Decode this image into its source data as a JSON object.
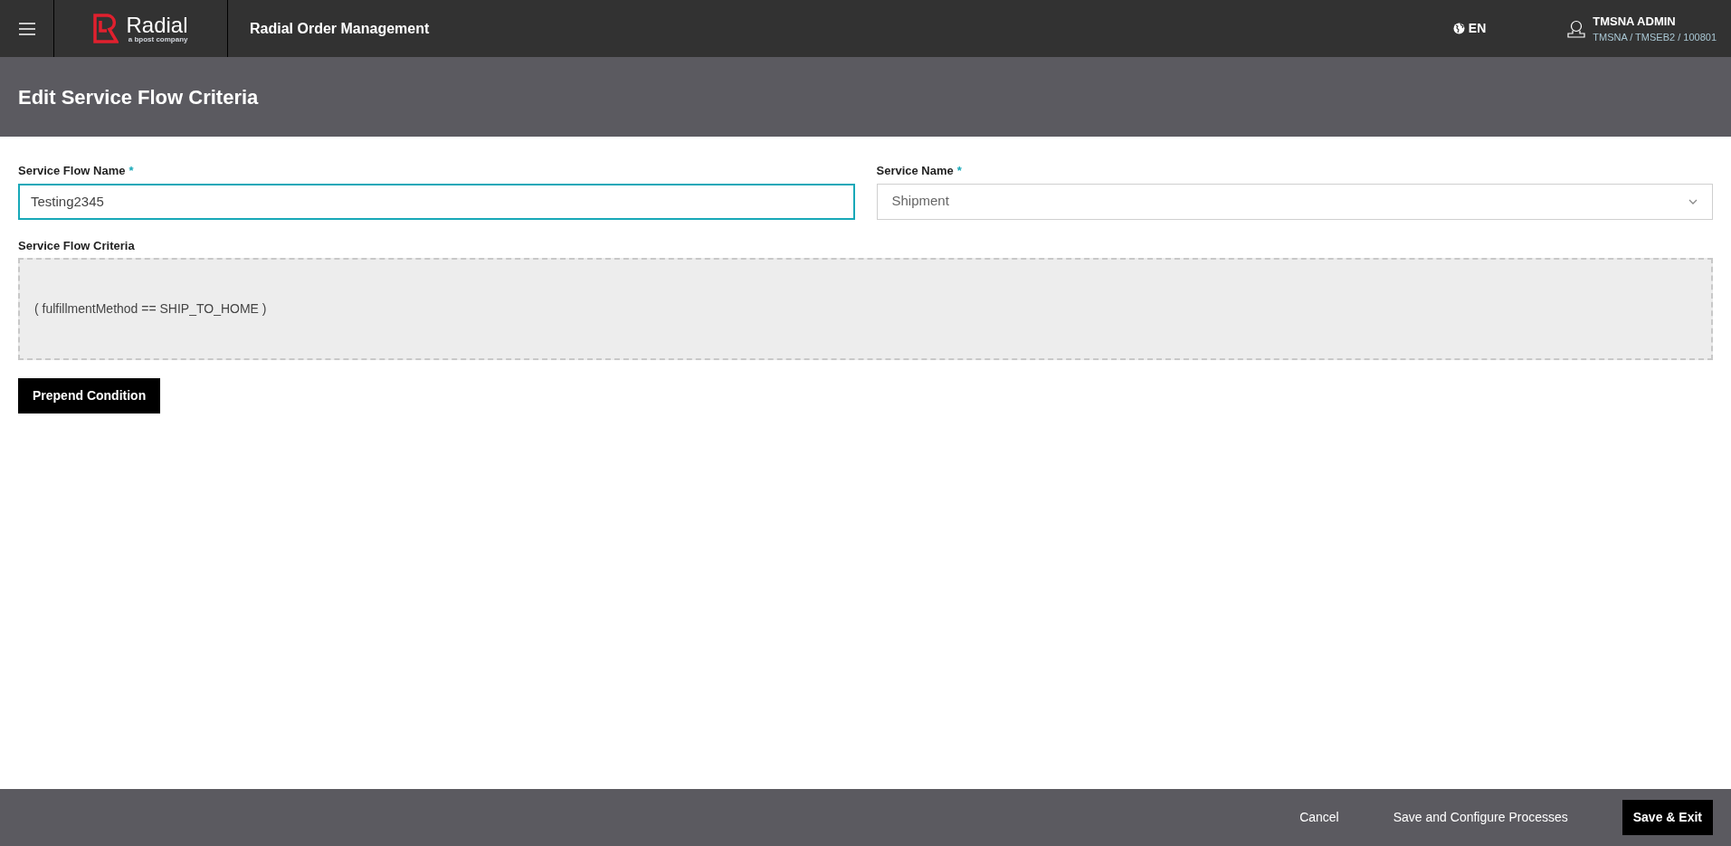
{
  "header": {
    "logo": {
      "name": "Radial",
      "tagline": "a bpost company"
    },
    "app_title": "Radial Order Management",
    "language": "EN",
    "user": {
      "name": "TMSNA ADMIN",
      "context": "TMSNA / TMSEB2 / 100801"
    }
  },
  "page_title": "Edit Service Flow Criteria",
  "form": {
    "fields": [
      {
        "kind": "text",
        "label": "Service Flow Name",
        "required_mark": "*",
        "value": "Testing2345",
        "focused": true
      },
      {
        "kind": "select",
        "label": "Service Name",
        "required_mark": "*",
        "value": "Shipment",
        "focused": false
      }
    ],
    "criteria": {
      "label": "Service Flow Criteria",
      "expression": "( fulfillmentMethod == SHIP_TO_HOME )"
    },
    "prepend_button": "Prepend Condition"
  },
  "footer": {
    "buttons": [
      {
        "label": "Cancel",
        "kind": "text"
      },
      {
        "label": "Save and Configure Processes",
        "kind": "text"
      },
      {
        "label": "Save & Exit",
        "kind": "primary"
      }
    ]
  }
}
